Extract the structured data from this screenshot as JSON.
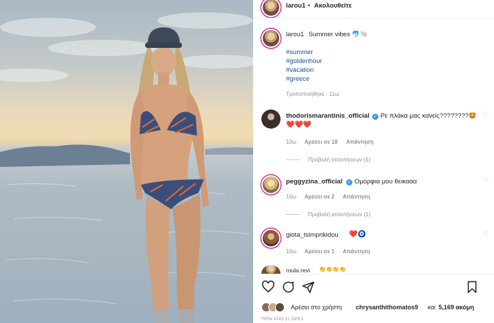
{
  "header": {
    "username": "larou1",
    "separator": "•",
    "follow_label": "Ακολουθείτε"
  },
  "caption": {
    "username": "larou1",
    "text": "Summer vibes 🐬🐚",
    "hashtags": [
      "#summer",
      "#goldenhour",
      "#vacation",
      "#greece"
    ],
    "edited": "Τροποποιήθηκε · 11ω"
  },
  "comments": [
    {
      "username": "thodorismarantinis_official",
      "verified": true,
      "text": "Ρε πλάκα μας κανείς????????🤩",
      "text2": "❤️❤️❤️",
      "time": "10ω",
      "likes": "Αρέσει σε 18",
      "reply": "Απάντηση",
      "view_replies": "Προβολή απαντήσεων (1)"
    },
    {
      "username": "peggyzina_official",
      "verified": true,
      "text": "Ομορφια μου θεικααα",
      "time": "10ω",
      "likes": "Αρέσει σε 2",
      "reply": "Απάντηση",
      "view_replies": "Προβολή απαντήσεων (1)"
    },
    {
      "username": "giota_tsimprikidou",
      "verified": false,
      "text": "❤️🧿",
      "time": "10ω",
      "likes": "Αρέσει σε 1",
      "reply": "Απάντηση"
    },
    {
      "username": "roula.revi",
      "text": "👏👏👏👏"
    }
  ],
  "actions": {
    "like_icon": "heart-icon",
    "comment_icon": "comment-icon",
    "share_icon": "share-icon",
    "save_icon": "bookmark-icon"
  },
  "likes_line": {
    "prefix": "Αρέσει στο χρήστη",
    "user": "chrysanthithomatos9",
    "middle": "και",
    "count": "5,169 ακόμη"
  },
  "posted_time": "ΠΡΙΝ ΑΠΟ 11 ΩΡΕΣ"
}
